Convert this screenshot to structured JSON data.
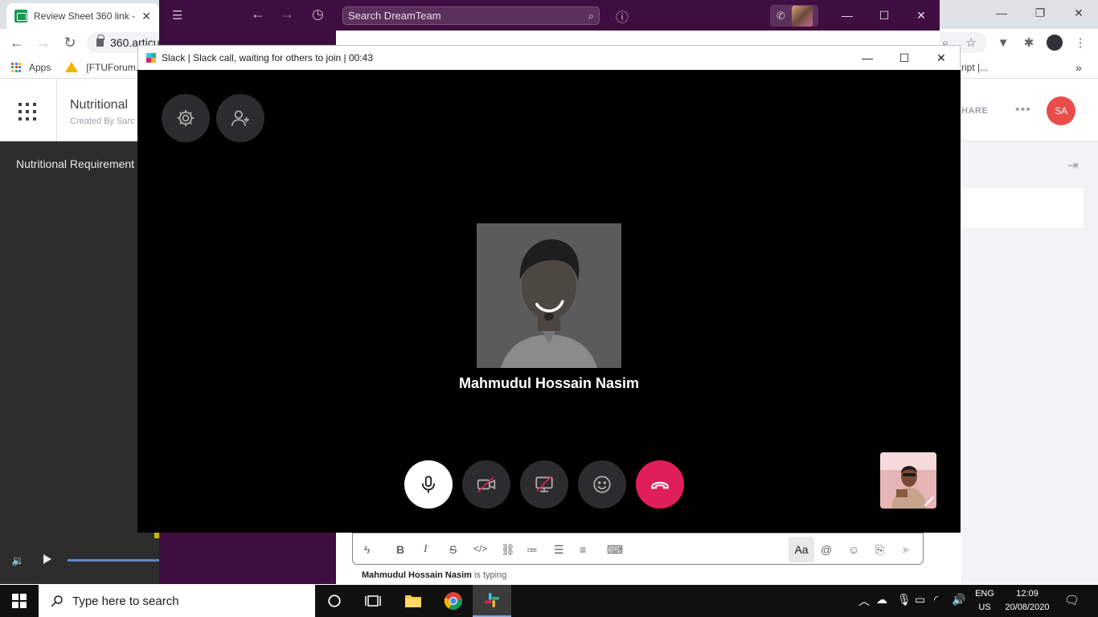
{
  "chrome": {
    "tab_title": "Review Sheet 360 link -",
    "tab_close": "✕",
    "address": "360.articu",
    "bookmarks": {
      "apps": "Apps",
      "ftuforum": "[FTUForum.c",
      "script": "ript |...",
      "more": "»"
    }
  },
  "page": {
    "doc_title": "Nutritional",
    "doc_sub": "Created By Sarc",
    "left_panel_title": "Nutritional Requirement",
    "share": "HARE",
    "avatar_initials": "SA",
    "accent_color": "#ea4c4c"
  },
  "slack": {
    "search_placeholder": "Search DreamTeam",
    "composer_aa": "Aa",
    "typing_user": "Mahmudul Hossain Nasim",
    "typing_suffix": " is typing"
  },
  "call": {
    "window_title": "Slack | Slack call, waiting for others to join | 00:43",
    "participant_name": "Mahmudul Hossain Nasim",
    "hangup_color": "#e01e5a"
  },
  "taskbar": {
    "search_placeholder": "Type here to search",
    "lang_line1": "ENG",
    "lang_line2": "US",
    "time": "12:09",
    "date": "20/08/2020"
  }
}
